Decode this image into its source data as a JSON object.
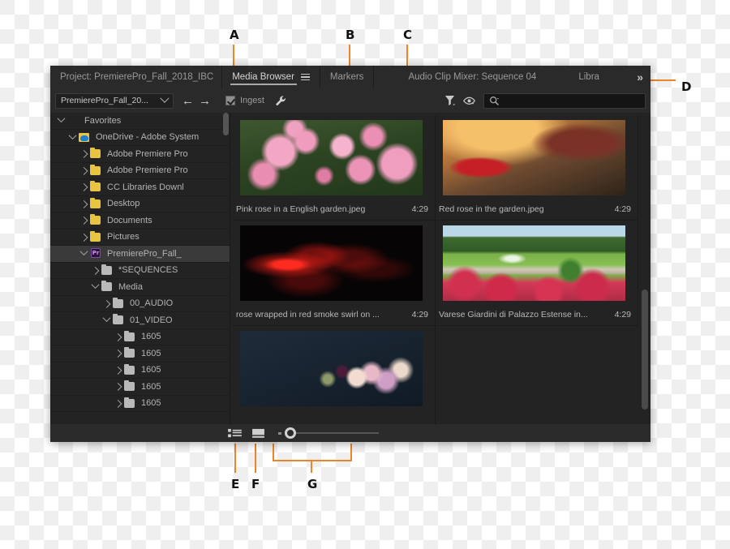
{
  "callouts": [
    {
      "letter": "A",
      "target": "ingest-checkbox"
    },
    {
      "letter": "B",
      "target": "ingest-settings-wrench"
    },
    {
      "letter": "C",
      "target": "filter-funnel"
    },
    {
      "letter": "D",
      "target": "search-field"
    },
    {
      "letter": "E",
      "target": "list-view-button"
    },
    {
      "letter": "F",
      "target": "thumbnail-view-button"
    },
    {
      "letter": "G",
      "target": "zoom-slider"
    }
  ],
  "tabs": [
    {
      "label": "Project: PremierePro_Fall_2018_IBC",
      "active": false,
      "has_menu": false
    },
    {
      "label": "Media Browser",
      "active": true,
      "has_menu": true
    },
    {
      "label": "Markers",
      "active": false,
      "has_menu": false
    },
    {
      "label": "Audio Clip Mixer: Sequence 04",
      "active": false,
      "has_menu": false
    },
    {
      "label": "Libra",
      "active": false,
      "has_menu": false
    }
  ],
  "tabbar": {
    "overflow_label": "»"
  },
  "toolbar": {
    "path_value": "PremierePro_Fall_20...",
    "back_arrow": "←",
    "forward_arrow": "→",
    "ingest_label": "Ingest",
    "ingest_checked": true,
    "wrench_icon": "wrench-icon",
    "funnel_icon": "filter-funnel-icon",
    "eye_icon": "eye-icon",
    "search_placeholder": ""
  },
  "sidebar": {
    "items": [
      {
        "label": "Favorites",
        "indent": 0,
        "twisty": "open",
        "icon": "none",
        "selected": false
      },
      {
        "label": "OneDrive - Adobe System",
        "indent": 1,
        "twisty": "open",
        "icon": "onedrive",
        "selected": false
      },
      {
        "label": "Adobe Premiere Pro",
        "indent": 2,
        "twisty": "closed",
        "icon": "folder-yellow",
        "selected": false
      },
      {
        "label": "Adobe Premiere Pro",
        "indent": 2,
        "twisty": "closed",
        "icon": "folder-yellow",
        "selected": false
      },
      {
        "label": "CC Libraries Downl",
        "indent": 2,
        "twisty": "closed",
        "icon": "folder-yellow",
        "selected": false
      },
      {
        "label": "Desktop",
        "indent": 2,
        "twisty": "closed",
        "icon": "folder-yellow",
        "selected": false
      },
      {
        "label": "Documents",
        "indent": 2,
        "twisty": "closed",
        "icon": "folder-yellow",
        "selected": false
      },
      {
        "label": "Pictures",
        "indent": 2,
        "twisty": "closed",
        "icon": "folder-yellow",
        "selected": false
      },
      {
        "label": "PremierePro_Fall_",
        "indent": 2,
        "twisty": "open",
        "icon": "premiere",
        "selected": true
      },
      {
        "label": "*SEQUENCES",
        "indent": 3,
        "twisty": "closed",
        "icon": "folder-gray",
        "selected": false
      },
      {
        "label": "Media",
        "indent": 3,
        "twisty": "open",
        "icon": "folder-gray",
        "selected": false
      },
      {
        "label": "00_AUDIO",
        "indent": 4,
        "twisty": "closed",
        "icon": "folder-gray",
        "selected": false
      },
      {
        "label": "01_VIDEO",
        "indent": 4,
        "twisty": "open",
        "icon": "folder-gray",
        "selected": false
      },
      {
        "label": "1605",
        "indent": 5,
        "twisty": "closed",
        "icon": "folder-gray",
        "selected": false
      },
      {
        "label": "1605",
        "indent": 5,
        "twisty": "closed",
        "icon": "folder-gray",
        "selected": false
      },
      {
        "label": "1605",
        "indent": 5,
        "twisty": "closed",
        "icon": "folder-gray",
        "selected": false
      },
      {
        "label": "1605",
        "indent": 5,
        "twisty": "closed",
        "icon": "folder-gray",
        "selected": false
      },
      {
        "label": "1605",
        "indent": 5,
        "twisty": "closed",
        "icon": "folder-gray",
        "selected": false
      }
    ]
  },
  "thumbnails": [
    {
      "name": "Pink rose in a English garden.jpeg",
      "duration": "4:29",
      "art": "img-pink-roses"
    },
    {
      "name": "Red rose in the garden.jpeg",
      "duration": "4:29",
      "art": "img-red-rose-sunset"
    },
    {
      "name": "rose wrapped in red smoke swirl on ...",
      "duration": "4:29",
      "art": "img-red-smoke"
    },
    {
      "name": "Varese Giardini di Palazzo Estense in...",
      "duration": "4:29",
      "art": "img-garden"
    },
    {
      "name": "",
      "duration": "",
      "art": "img-bouquet"
    }
  ],
  "statusbar": {
    "list_view_icon": "list-view-icon",
    "thumbnail_view_icon": "thumbnail-view-icon",
    "zoom_value": "small"
  },
  "colors": {
    "callout_accent": "#e8862a",
    "panel_bg": "#232323",
    "chrome_bg": "#2a2a2a",
    "selection": "#3a3a3a"
  }
}
